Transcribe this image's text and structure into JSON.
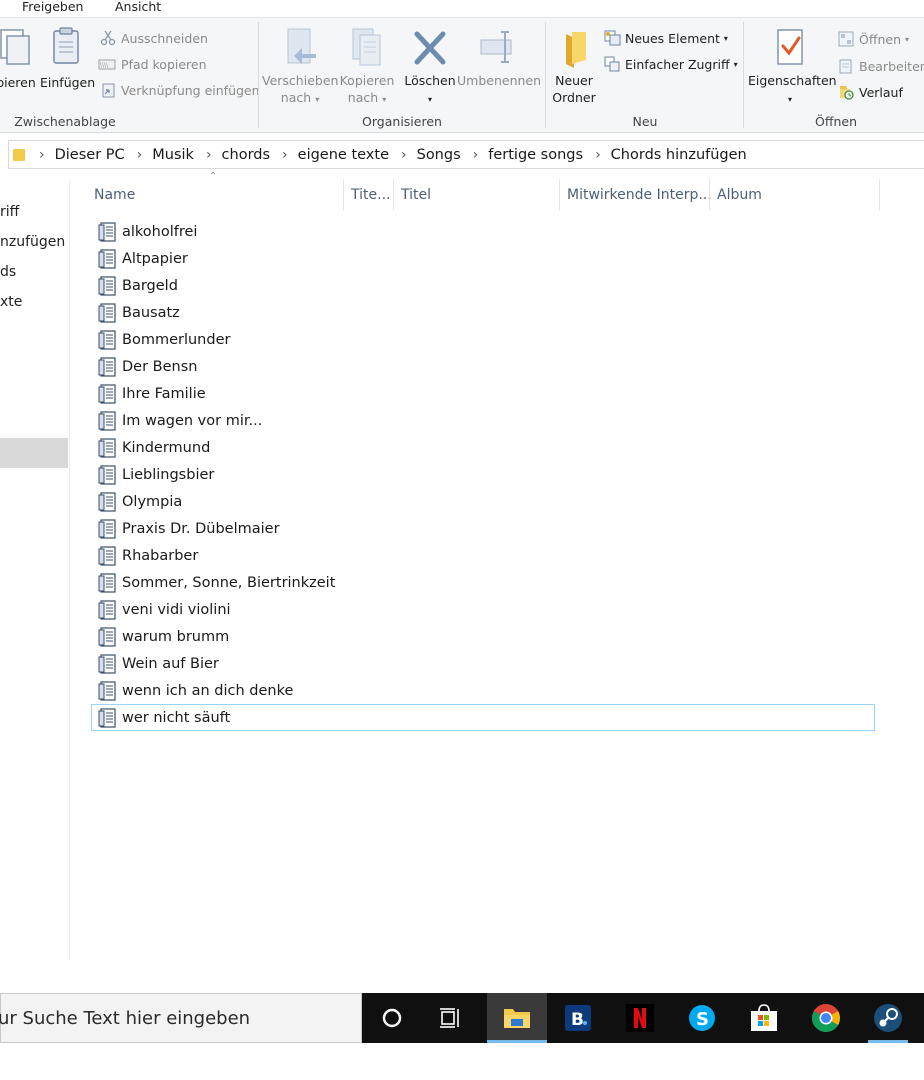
{
  "ribbon_tabs": [
    "Freigeben",
    "Ansicht"
  ],
  "ribbon": {
    "clipboard": {
      "copy_label": "pieren",
      "paste_label": "Einfügen",
      "cut_label": "Ausschneiden",
      "copy_path_label": "Pfad kopieren",
      "paste_shortcut_label": "Verknüpfung einfügen",
      "group_label": "Zwischenablage"
    },
    "organize": {
      "move_line1": "Verschieben",
      "move_line2": "nach",
      "copy_line1": "Kopieren",
      "copy_line2": "nach",
      "delete_label": "Löschen",
      "rename_label": "Umbenennen",
      "group_label": "Organisieren"
    },
    "new": {
      "new_folder_line1": "Neuer",
      "new_folder_line2": "Ordner",
      "new_item_label": "Neues Element",
      "easy_access_label": "Einfacher Zugriff",
      "group_label": "Neu"
    },
    "open": {
      "properties_label": "Eigenschaften",
      "open_label": "Öffnen",
      "edit_label": "Bearbeiten",
      "history_label": "Verlauf",
      "group_label": "Öffnen"
    }
  },
  "breadcrumb": [
    "Dieser PC",
    "Musik",
    "chords",
    "eigene texte",
    "Songs",
    "fertige songs",
    "Chords hinzufügen"
  ],
  "nav_items": [
    "riff",
    "nzufügen",
    "ds",
    "xte"
  ],
  "columns": [
    "Name",
    "Tite...",
    "Titel",
    "Mitwirkende Interp...",
    "Album"
  ],
  "files": [
    "alkoholfrei",
    "Altpapier",
    "Bargeld",
    "Bausatz",
    "Bommerlunder",
    "Der Bensn",
    "Ihre Familie",
    "Im wagen vor mir...",
    "Kindermund",
    "Lieblingsbier",
    "Olympia",
    "Praxis Dr. Dübelmaier",
    "Rhabarber",
    "Sommer, Sonne, Biertrinkzeit",
    "veni vidi violini",
    "warum brumm",
    "Wein auf Bier",
    "wenn ich an dich denke",
    "wer nicht säuft"
  ],
  "taskbar": {
    "search_text": "ur Suche Text hier eingeben",
    "apps": [
      "cortana-icon",
      "task-view-icon",
      "file-explorer-icon",
      "booking-icon",
      "netflix-icon",
      "skype-icon",
      "microsoft-store-icon",
      "chrome-icon",
      "steam-icon"
    ]
  },
  "colors": {
    "ribbon_bg": "#f5f6f7",
    "focus_border": "#99d1ff",
    "column_header_text": "#4c607a",
    "taskbar_bg": "#101010",
    "taskbar_active": "#3a3a3a",
    "taskbar_underline": "#76b9ed"
  }
}
